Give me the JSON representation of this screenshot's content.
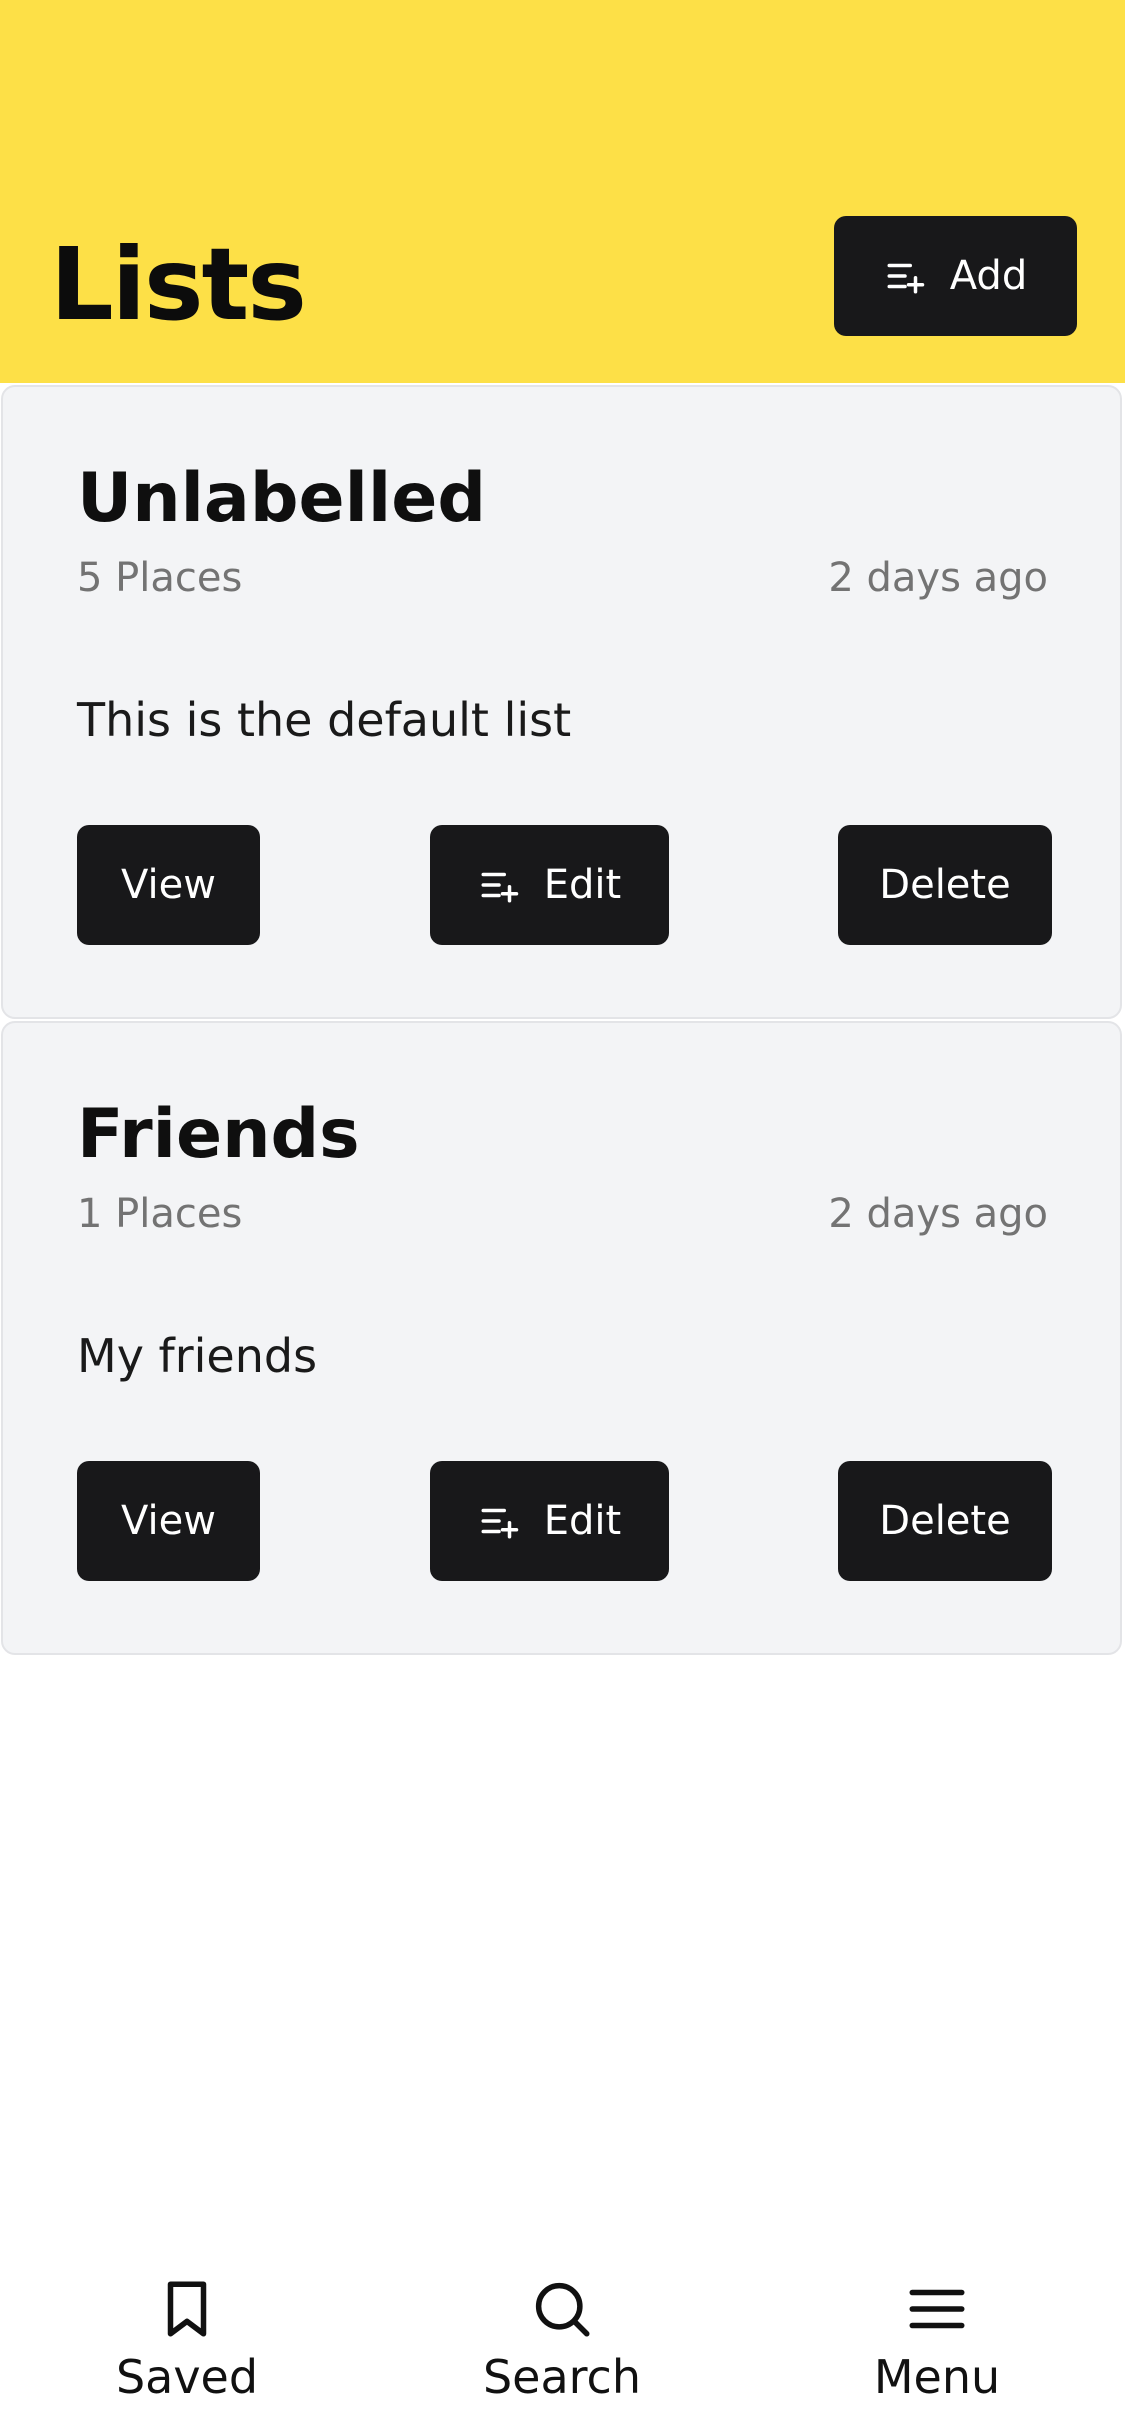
{
  "header": {
    "title": "Lists",
    "add_label": "Add",
    "background_color": "#fde047"
  },
  "lists": [
    {
      "title": "Unlabelled",
      "places": "5 Places",
      "updated": "2 days ago",
      "description": "This is the default list",
      "view_label": "View",
      "edit_label": "Edit",
      "delete_label": "Delete"
    },
    {
      "title": "Friends",
      "places": "1 Places",
      "updated": "2 days ago",
      "description": "My friends",
      "view_label": "View",
      "edit_label": "Edit",
      "delete_label": "Delete"
    }
  ],
  "bottom_nav": {
    "items": [
      {
        "label": "Saved",
        "icon": "bookmark-icon"
      },
      {
        "label": "Search",
        "icon": "search-icon"
      },
      {
        "label": "Menu",
        "icon": "menu-icon"
      }
    ]
  },
  "colors": {
    "button_background": "#18181a",
    "card_background": "#f3f4f6",
    "muted_text": "#737373"
  }
}
